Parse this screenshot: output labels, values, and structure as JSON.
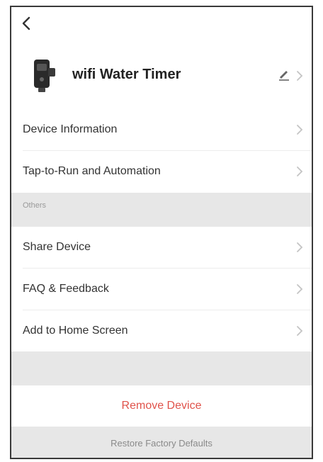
{
  "nav": {
    "back_icon": "chevron-left-icon"
  },
  "device": {
    "name": "wifi Water Timer",
    "icon": "water-timer-device-icon",
    "edit_icon": "pencil-icon"
  },
  "menu": [
    {
      "label": "Device Information"
    },
    {
      "label": "Tap-to-Run and Automation"
    }
  ],
  "others_section": {
    "title": "Others",
    "items": [
      {
        "label": "Share Device"
      },
      {
        "label": "FAQ & Feedback"
      },
      {
        "label": "Add to Home Screen"
      }
    ]
  },
  "actions": {
    "remove_label": "Remove Device",
    "restore_label": "Restore Factory Defaults"
  },
  "colors": {
    "danger": "#e0534b",
    "section_bg": "#e7e7e7",
    "chevron": "#c4c4c4"
  }
}
